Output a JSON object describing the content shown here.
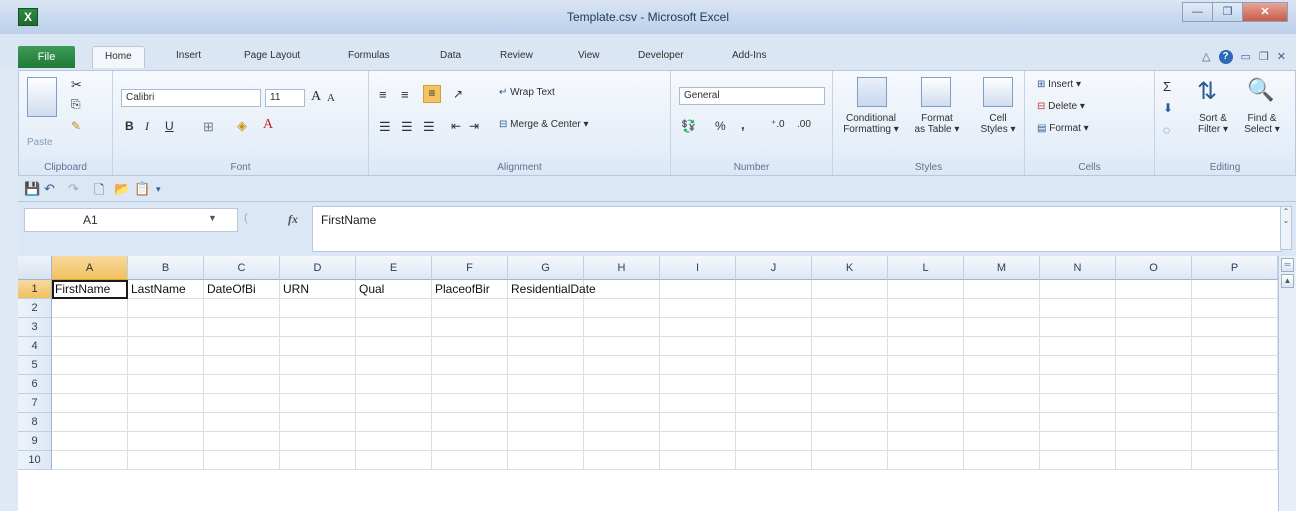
{
  "window": {
    "title": "Template.csv - Microsoft Excel",
    "app_icon_letter": "X",
    "buttons": {
      "minimize": "—",
      "restore": "❐",
      "close": "✕"
    }
  },
  "tabs": {
    "file": "File",
    "items": [
      "Home",
      "Insert",
      "Page Layout",
      "Formulas",
      "Data",
      "Review",
      "View",
      "Developer",
      "Add-Ins"
    ],
    "active": "Home",
    "help_icon": "?"
  },
  "ribbon": {
    "clipboard": {
      "label": "Clipboard",
      "paste": "Paste"
    },
    "font": {
      "label": "Font",
      "family": "Calibri",
      "size": "11",
      "bold": "B",
      "italic": "I",
      "underline": "U",
      "grow": "A",
      "shrink": "A"
    },
    "alignment": {
      "label": "Alignment",
      "wrap": "Wrap Text",
      "merge": "Merge & Center"
    },
    "number": {
      "label": "Number",
      "format": "General",
      "percent": "%",
      "comma": ","
    },
    "styles": {
      "label": "Styles",
      "conditional": "Conditional Formatting",
      "conditional_l1": "Conditional",
      "conditional_l2": "Formatting",
      "format_table_l1": "Format",
      "format_table_l2": "as Table",
      "cell_styles_l1": "Cell",
      "cell_styles_l2": "Styles"
    },
    "cells": {
      "label": "Cells",
      "insert": "Insert",
      "delete": "Delete",
      "format": "Format"
    },
    "editing": {
      "label": "Editing",
      "sort_l1": "Sort &",
      "sort_l2": "Filter",
      "find_l1": "Find &",
      "find_l2": "Select",
      "sigma": "Σ"
    }
  },
  "formula_bar": {
    "name_box": "A1",
    "fx": "fx",
    "content": "FirstName"
  },
  "sheet": {
    "columns": [
      "A",
      "B",
      "C",
      "D",
      "E",
      "F",
      "G",
      "H",
      "I",
      "J",
      "K",
      "L",
      "M",
      "N",
      "O",
      "P"
    ],
    "rows": [
      "1",
      "2",
      "3",
      "4",
      "5",
      "6",
      "7",
      "8",
      "9",
      "10"
    ],
    "row1": [
      "FirstName",
      "LastName",
      "DateOfBi",
      "URN",
      "Qual",
      "PlaceofBir",
      "ResidentialDate"
    ]
  },
  "colors": {
    "file_tab": "#1f7a36",
    "selection_header": "#f1c15f",
    "ribbon_bg": "#e6eef8"
  }
}
